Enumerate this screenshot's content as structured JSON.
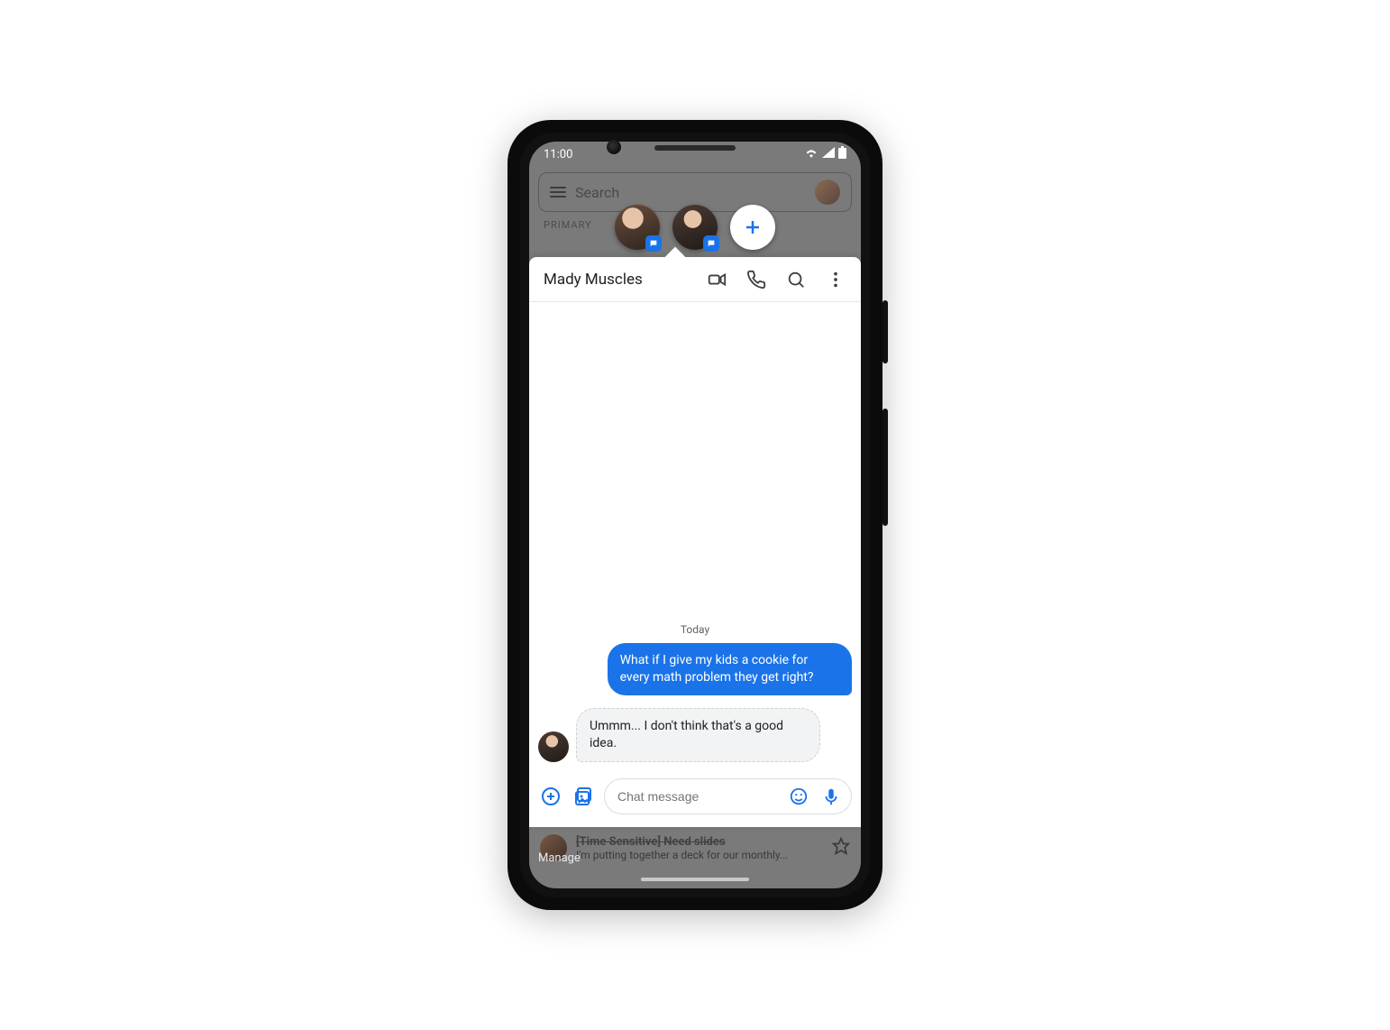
{
  "statusbar": {
    "time": "11:00"
  },
  "background": {
    "search_placeholder": "Search",
    "section_label": "PRIMARY",
    "peek_subject": "[Time Sensitive] Need slides",
    "peek_snippet": "I'm putting together a deck for our monthly...",
    "manage_label": "Manage"
  },
  "bubbles": {
    "items": [
      {
        "name": "contact-1"
      },
      {
        "name": "contact-2-mady"
      }
    ]
  },
  "conversation": {
    "title": "Mady Muscles",
    "day_label": "Today",
    "messages": {
      "outgoing_1": "What if I give my kids a cookie for every math problem they get right?",
      "incoming_1": "Ummm... I don't think that's a good idea."
    },
    "compose_placeholder": "Chat message"
  }
}
